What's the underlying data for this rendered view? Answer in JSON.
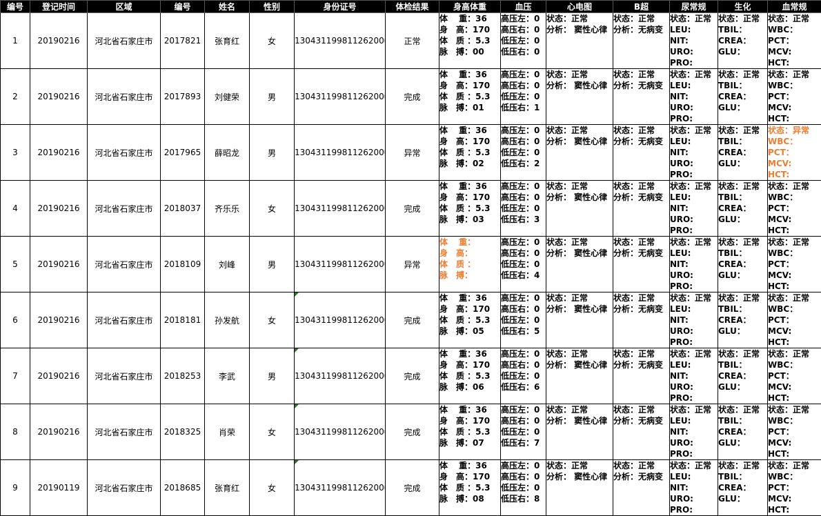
{
  "headers": [
    "编号",
    "登记时间",
    "区域",
    "编号",
    "姓名",
    "性别",
    "身份证号",
    "体检结果",
    "身高体重",
    "血压",
    "心电图",
    "B超",
    "尿常规",
    "生化",
    "血常规"
  ],
  "colors": {
    "normal": "#70ad47",
    "abnormal": "#ed7d31",
    "header_bg": "#000000"
  },
  "rows": [
    {
      "no": "1",
      "date": "20190216",
      "region": "河北省石家庄市",
      "code": "2017821",
      "name": "张育红",
      "gender": "女",
      "id_number": "130431199811262000",
      "result": "正常",
      "id_marker": false,
      "body": [
        "体　 重：36",
        "身　高：170",
        "体　质 ：5.3",
        "脉　搏：00"
      ],
      "body_abnormal": false,
      "bp": [
        "高压左：0",
        "高压右：0",
        "低压左：0",
        "低压右：0"
      ],
      "ecg": [
        "状态：正常",
        "分析： 窦性心律"
      ],
      "bscan": [
        "状态：正常",
        "分析：无病变"
      ],
      "urine": [
        "状态：正常",
        "LEU:",
        "NIT:",
        "URO:",
        "PRO:"
      ],
      "biochem": [
        "状态：正常",
        "TBIL：",
        "CREA：",
        "GLU："
      ],
      "blood": [
        "状态：正常",
        "WBC：",
        "PCT：",
        "MCV:",
        "HCT:"
      ],
      "blood_abnormal": false
    },
    {
      "no": "2",
      "date": "20190216",
      "region": "河北省石家庄市",
      "code": "2017893",
      "name": "刘健荣",
      "gender": "男",
      "id_number": "130431199811262000",
      "result": "完成",
      "id_marker": false,
      "body": [
        "体　 重：36",
        "身　高：170",
        "体　质 ：5.3",
        "脉　搏：01"
      ],
      "body_abnormal": false,
      "bp": [
        "高压左：0",
        "高压右：0",
        "低压左：0",
        "低压右：1"
      ],
      "ecg": [
        "状态：正常",
        "分析： 窦性心律"
      ],
      "bscan": [
        "状态：正常",
        "分析：无病变"
      ],
      "urine": [
        "状态：正常",
        "LEU:",
        "NIT:",
        "URO:",
        "PRO:"
      ],
      "biochem": [
        "状态：正常",
        "TBIL：",
        "CREA：",
        "GLU："
      ],
      "blood": [
        "状态：正常",
        "WBC：",
        "PCT：",
        "MCV:",
        "HCT:"
      ],
      "blood_abnormal": false
    },
    {
      "no": "3",
      "date": "20190216",
      "region": "河北省石家庄市",
      "code": "2017965",
      "name": "薛昭龙",
      "gender": "男",
      "id_number": "130431199811262000",
      "result": "异常",
      "id_marker": false,
      "body": [
        "体　 重：36",
        "身　高：170",
        "体　质 ：5.3",
        "脉　搏：02"
      ],
      "body_abnormal": false,
      "bp": [
        "高压左：0",
        "高压右：0",
        "低压左：0",
        "低压右：2"
      ],
      "ecg": [
        "状态：正常",
        "分析： 窦性心律"
      ],
      "bscan": [
        "状态：正常",
        "分析：无病变"
      ],
      "urine": [
        "状态：正常",
        "LEU:",
        "NIT:",
        "URO:",
        "PRO:"
      ],
      "biochem": [
        "状态：正常",
        "TBIL：",
        "CREA：",
        "GLU："
      ],
      "blood": [
        "状态：异常",
        "WBC：",
        "PCT：",
        "MCV:",
        "HCT:"
      ],
      "blood_abnormal": true
    },
    {
      "no": "4",
      "date": "20190216",
      "region": "河北省石家庄市",
      "code": "2018037",
      "name": "齐乐乐",
      "gender": "女",
      "id_number": "130431199811262000",
      "result": "完成",
      "id_marker": false,
      "body": [
        "体　 重：36",
        "身　高：170",
        "体　质 ：5.3",
        "脉　搏：03"
      ],
      "body_abnormal": false,
      "bp": [
        "高压左：0",
        "高压右：0",
        "低压左：0",
        "低压右：3"
      ],
      "ecg": [
        "状态：正常",
        "分析： 窦性心律"
      ],
      "bscan": [
        "状态：正常",
        "分析：无病变"
      ],
      "urine": [
        "状态：正常",
        "LEU:",
        "NIT:",
        "URO:",
        "PRO:"
      ],
      "biochem": [
        "状态：正常",
        "TBIL：",
        "CREA：",
        "GLU："
      ],
      "blood": [
        "状态：正常",
        "WBC：",
        "PCT：",
        "MCV:",
        "HCT:"
      ],
      "blood_abnormal": false
    },
    {
      "no": "5",
      "date": "20190216",
      "region": "河北省石家庄市",
      "code": "2018109",
      "name": "刘峰",
      "gender": "男",
      "id_number": "130431199811262000",
      "result": "异常",
      "id_marker": false,
      "body": [
        "体　 重：",
        "身　高：",
        "体　质 ：",
        "脉　搏："
      ],
      "body_abnormal": true,
      "bp": [
        "高压左：0",
        "高压右：0",
        "低压左：0",
        "低压右：4"
      ],
      "ecg": [
        "状态：正常",
        "分析： 窦性心律"
      ],
      "bscan": [
        "状态：正常",
        "分析：无病变"
      ],
      "urine": [
        "状态：正常",
        "LEU:",
        "NIT:",
        "URO:",
        "PRO:"
      ],
      "biochem": [
        "状态：正常",
        "TBIL：",
        "CREA：",
        "GLU："
      ],
      "blood": [
        "状态：正常",
        "WBC：",
        "PCT：",
        "MCV:",
        "HCT:"
      ],
      "blood_abnormal": false
    },
    {
      "no": "6",
      "date": "20190216",
      "region": "河北省石家庄市",
      "code": "2018181",
      "name": "孙发航",
      "gender": "女",
      "id_number": "130431199811262000",
      "result": "完成",
      "id_marker": true,
      "body": [
        "体　 重：36",
        "身　高：170",
        "体　质 ：5.3",
        "脉　搏：05"
      ],
      "body_abnormal": false,
      "bp": [
        "高压左：0",
        "高压右：0",
        "低压左：0",
        "低压右：5"
      ],
      "ecg": [
        "状态：正常",
        "分析： 窦性心律"
      ],
      "bscan": [
        "状态：正常",
        "分析：无病变"
      ],
      "urine": [
        "状态：正常",
        "LEU:",
        "NIT:",
        "URO:",
        "PRO:"
      ],
      "biochem": [
        "状态：正常",
        "TBIL：",
        "CREA：",
        "GLU："
      ],
      "blood": [
        "状态：正常",
        "WBC：",
        "PCT：",
        "MCV:",
        "HCT:"
      ],
      "blood_abnormal": false
    },
    {
      "no": "7",
      "date": "20190216",
      "region": "河北省石家庄市",
      "code": "2018253",
      "name": "李武",
      "gender": "男",
      "id_number": "130431199811262000",
      "result": "完成",
      "id_marker": true,
      "body": [
        "体　 重：36",
        "身　高：170",
        "体　质 ：5.3",
        "脉　搏：06"
      ],
      "body_abnormal": false,
      "bp": [
        "高压左：0",
        "高压右：0",
        "低压左：0",
        "低压右：6"
      ],
      "ecg": [
        "状态：正常",
        "分析： 窦性心律"
      ],
      "bscan": [
        "状态：正常",
        "分析：无病变"
      ],
      "urine": [
        "状态：正常",
        "LEU:",
        "NIT:",
        "URO:",
        "PRO:"
      ],
      "biochem": [
        "状态：正常",
        "TBIL：",
        "CREA：",
        "GLU："
      ],
      "blood": [
        "状态：正常",
        "WBC：",
        "PCT：",
        "MCV:",
        "HCT:"
      ],
      "blood_abnormal": false
    },
    {
      "no": "8",
      "date": "20190216",
      "region": "河北省石家庄市",
      "code": "2018325",
      "name": "肖荣",
      "gender": "女",
      "id_number": "130431199811262000",
      "result": "完成",
      "id_marker": true,
      "body": [
        "体　 重：36",
        "身　高：170",
        "体　质 ：5.3",
        "脉　搏：07"
      ],
      "body_abnormal": false,
      "bp": [
        "高压左：0",
        "高压右：0",
        "低压左：0",
        "低压右：7"
      ],
      "ecg": [
        "状态：正常",
        "分析： 窦性心律"
      ],
      "bscan": [
        "状态：正常",
        "分析：无病变"
      ],
      "urine": [
        "状态：正常",
        "LEU:",
        "NIT:",
        "URO:",
        "PRO:"
      ],
      "biochem": [
        "状态：正常",
        "TBIL：",
        "CREA：",
        "GLU："
      ],
      "blood": [
        "状态：正常",
        "WBC：",
        "PCT：",
        "MCV:",
        "HCT:"
      ],
      "blood_abnormal": false
    },
    {
      "no": "9",
      "date": "20190119",
      "region": "河北省石家庄市",
      "code": "2018685",
      "name": "张育红",
      "gender": "女",
      "id_number": "130431199811262000",
      "result": "完成",
      "id_marker": true,
      "body": [
        "体　 重：36",
        "身　高：170",
        "体　质 ：5.3",
        "脉　搏：08"
      ],
      "body_abnormal": false,
      "bp": [
        "高压左：0",
        "高压右：0",
        "低压左：0",
        "低压右：8"
      ],
      "ecg": [
        "状态：正常",
        "分析： 窦性心律"
      ],
      "bscan": [
        "状态：正常",
        "分析：无病变"
      ],
      "urine": [
        "状态：正常",
        "LEU:",
        "NIT:",
        "URO:",
        "PRO:"
      ],
      "biochem": [
        "状态：正常",
        "TBIL：",
        "CREA：",
        "GLU："
      ],
      "blood": [
        "状态：正常",
        "WBC：",
        "PCT：",
        "MCV:",
        "HCT:"
      ],
      "blood_abnormal": false
    }
  ]
}
